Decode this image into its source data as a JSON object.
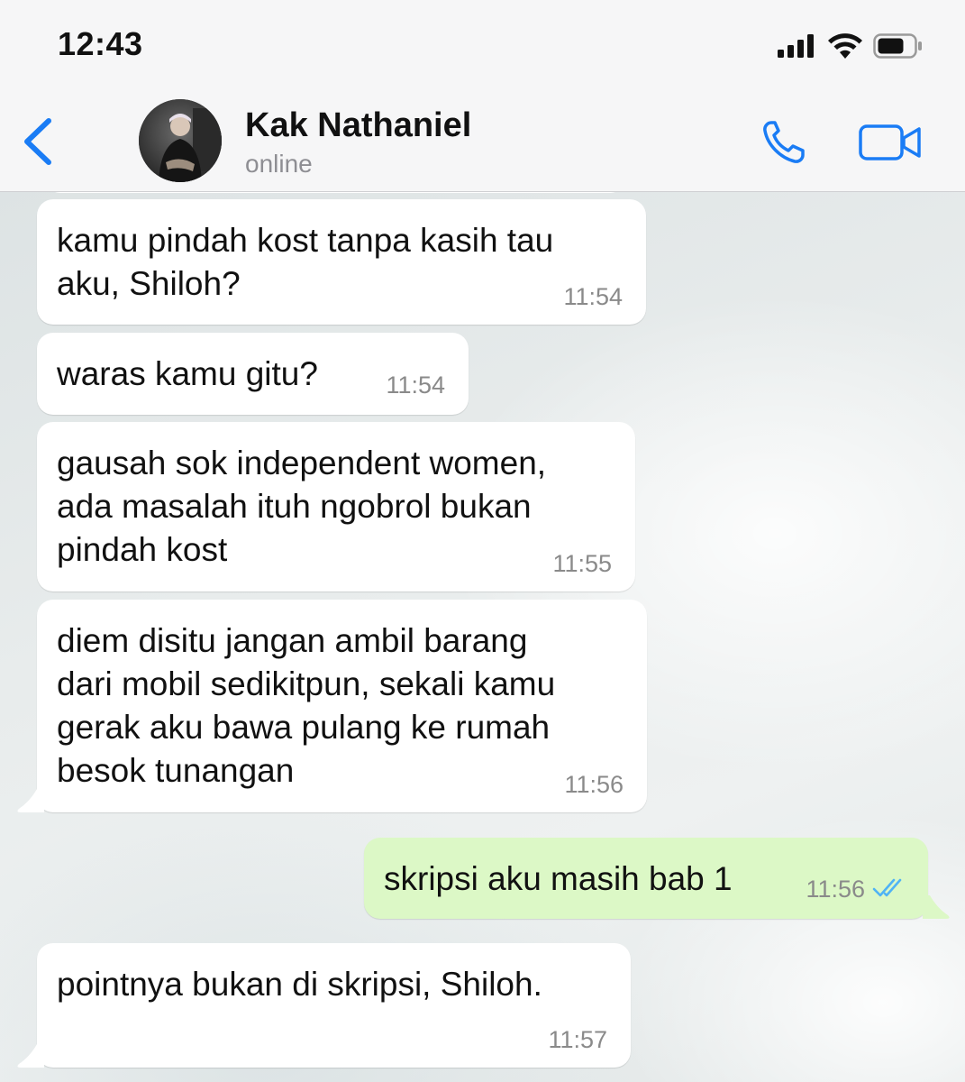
{
  "status_bar": {
    "time": "12:43"
  },
  "header": {
    "contact_name": "Kak Nathaniel",
    "contact_status": "online",
    "back_icon": "chevron-left-icon",
    "call_icon": "phone-icon",
    "video_icon": "video-camera-icon"
  },
  "colors": {
    "accent": "#1a7cf5",
    "incoming_bubble": "#ffffff",
    "outgoing_bubble": "#dcf8c6",
    "read_ticks": "#4fb3f5"
  },
  "messages": [
    {
      "direction": "in",
      "text": "kamu pindah kost tanpa kasih tau\naku, Shiloh?",
      "time": "11:54"
    },
    {
      "direction": "in",
      "text": "waras kamu gitu?",
      "time": "11:54"
    },
    {
      "direction": "in",
      "text": "gausah sok independent women,\nada masalah ituh ngobrol bukan\npindah kost",
      "time": "11:55"
    },
    {
      "direction": "in",
      "text": "diem disitu jangan ambil barang\ndari mobil sedikitpun, sekali kamu\ngerak aku bawa pulang ke rumah\nbesok tunangan",
      "time": "11:56"
    },
    {
      "direction": "out",
      "text": "skripsi aku masih bab 1",
      "time": "11:56",
      "status": "read"
    },
    {
      "direction": "in",
      "text": "pointnya bukan di skripsi, Shiloh.",
      "time": "11:57"
    }
  ]
}
